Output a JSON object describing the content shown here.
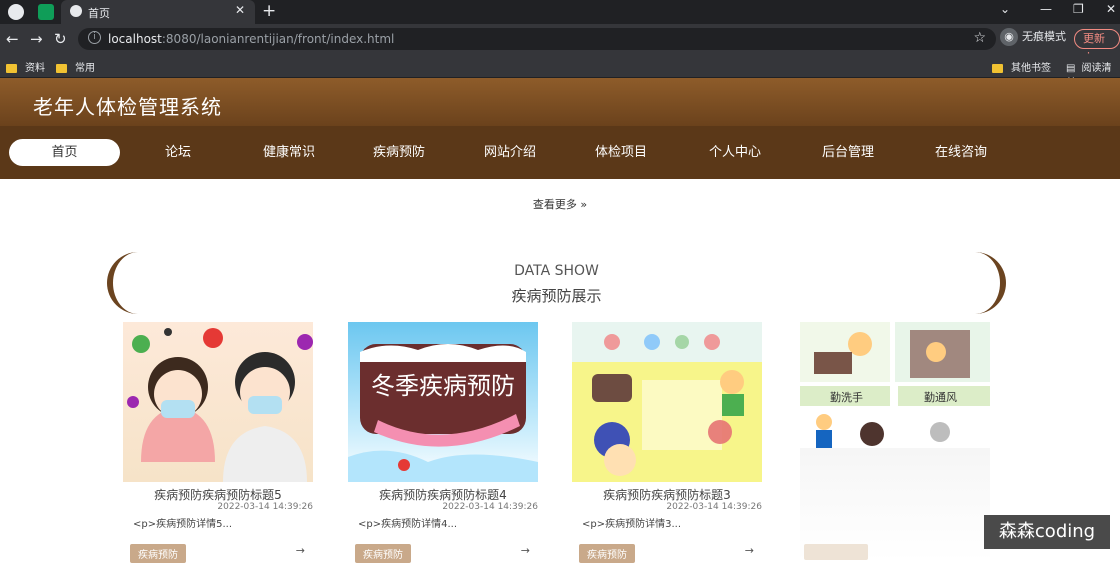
{
  "browser": {
    "tab_title": "首页",
    "url_host": "localhost",
    "url_rest": ":8080/laonianrentijian/front/index.html",
    "incognito_label": "无痕模式",
    "update_label": "更新",
    "bookmarks": [
      "资料",
      "常用",
      "其他书签",
      "阅读清单"
    ]
  },
  "site": {
    "title": "老年人体检管理系统",
    "nav": [
      "首页",
      "论坛",
      "健康常识",
      "疾病预防",
      "网站介绍",
      "体检项目",
      "个人中心",
      "后台管理",
      "在线咨询"
    ],
    "more_label": "查看更多"
  },
  "section": {
    "title_en": "DATA SHOW",
    "title_cn": "疾病预防展示"
  },
  "cards": [
    {
      "title": "疾病预防疾病预防标题5",
      "date": "2022-03-14 14:39:26",
      "desc": "<p>疾病预防详情5...",
      "tag": "疾病预防",
      "image_text": ""
    },
    {
      "title": "疾病预防疾病预防标题4",
      "date": "2022-03-14 14:39:26",
      "desc": "<p>疾病预防详情4...",
      "tag": "疾病预防",
      "image_text": "冬季疾病预防"
    },
    {
      "title": "疾病预防疾病预防标题3",
      "date": "2022-03-14 14:39:26",
      "desc": "<p>疾病预防详情3...",
      "tag": "疾病预防",
      "image_text": ""
    },
    {
      "title": "",
      "date": "",
      "desc": "",
      "tag": "",
      "image_text": "勤洗手 勤通风"
    }
  ],
  "watermark": "森森coding",
  "colors": {
    "header_brown": "#7a4e24",
    "nav_brown": "#5b3818",
    "tag_bg": "#c9a98a"
  }
}
